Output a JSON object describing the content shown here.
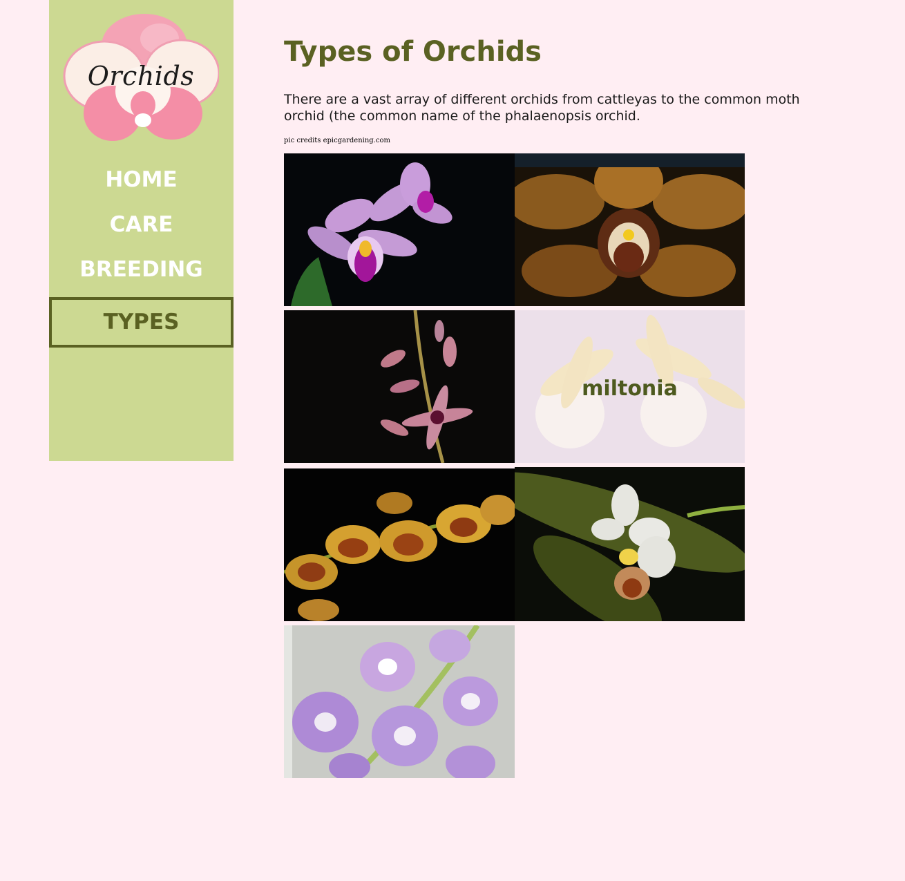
{
  "sidebar": {
    "logo_text": "Orchids",
    "nav": [
      {
        "label": "HOME"
      },
      {
        "label": "CARE"
      },
      {
        "label": "BREEDING"
      },
      {
        "label": "TYPES",
        "active": true
      }
    ]
  },
  "main": {
    "title": "Types of Orchids",
    "intro": "There are a vast array of different orchids from cattleyas to the common moth orchid (the common name of the phalaenopsis orchid.",
    "credits": "pic credits epicgardening.com",
    "gallery": [
      {
        "hover_label": ""
      },
      {
        "hover_label": ""
      },
      {
        "hover_label": ""
      },
      {
        "hover_label": "miltonia"
      },
      {
        "hover_label": ""
      },
      {
        "hover_label": ""
      },
      {
        "hover_label": ""
      }
    ]
  },
  "colors": {
    "page_background": "#ffeef3",
    "sidebar_background": "#ccd992",
    "accent_olive": "#5a6122"
  }
}
